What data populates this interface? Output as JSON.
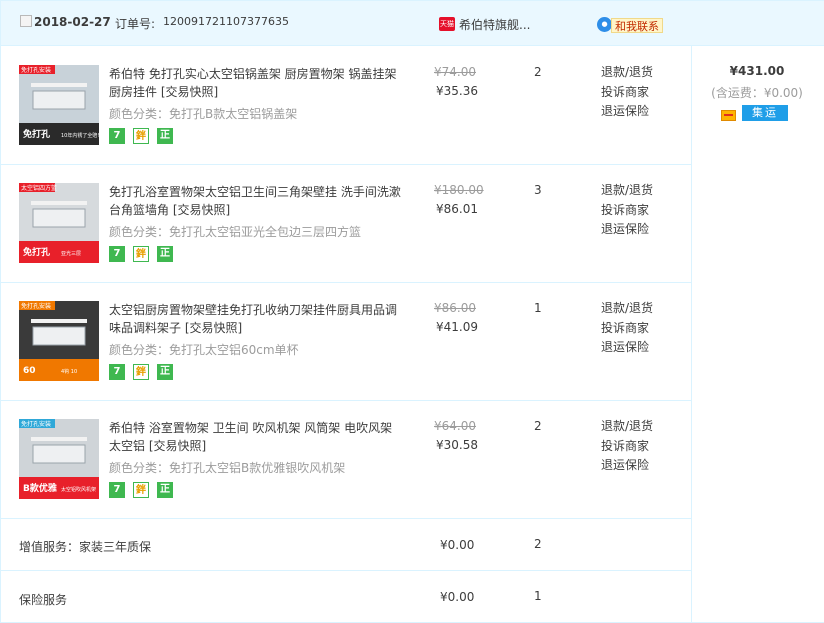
{
  "order": {
    "date": "2018-02-27",
    "order_label": "订单号:",
    "order_number": "120091721107377635",
    "tmall_icon": "天猫",
    "shop_name": "希伯特旗舰...",
    "contact_label": "和我联系",
    "contact_icon": "chat-bubble-icon"
  },
  "items": [
    {
      "title": "希伯特 免打孔实心太空铝锅盖架 厨房置物架 锅盖挂架 厨房挂件 [交易快照]",
      "spec": "颜色分类：免打孔B款太空铝锅盖架",
      "old_price": "¥74.00",
      "price": "¥35.36",
      "qty": "2",
      "thumb_text": "免打孔",
      "thumb_sub": "10年内锈了全赔!",
      "thumb_top": "免打孔安装",
      "colors": {
        "top": "#c8d2d9",
        "bottom": "#2a2a2a",
        "accent": "#e8202a"
      }
    },
    {
      "title": "免打孔浴室置物架太空铝卫生间三角架壁挂 洗手间洗漱台角篮墙角 [交易快照]",
      "spec": "颜色分类：免打孔太空铝亚光全包边三层四方篮",
      "old_price": "¥180.00",
      "price": "¥86.01",
      "qty": "3",
      "thumb_text": "免打孔",
      "thumb_sub": "亚光三层",
      "thumb_top": "太空铝四方篮",
      "colors": {
        "top": "#d6dadd",
        "bottom": "#e8202a",
        "accent": "#e8202a"
      }
    },
    {
      "title": "太空铝厨房置物架壁挂免打孔收纳刀架挂件厨具用品调味品调料架子 [交易快照]",
      "spec": "颜色分类：免打孔太空铝60cm单杯",
      "old_price": "¥86.00",
      "price": "¥41.09",
      "qty": "1",
      "thumb_text": "60",
      "thumb_sub": "4钩 10",
      "thumb_top": "免打孔安装",
      "colors": {
        "top": "#3a3a3a",
        "bottom": "#f07800",
        "accent": "#f07800"
      }
    },
    {
      "title": "希伯特 浴室置物架 卫生间 吹风机架 风筒架 电吹风架 太空铝 [交易快照]",
      "spec": "颜色分类：免打孔太空铝B款优雅银吹风机架",
      "old_price": "¥64.00",
      "price": "¥30.58",
      "qty": "2",
      "thumb_text": "B款优雅",
      "thumb_sub": "太空铝吹风机架",
      "thumb_top": "免打孔安装",
      "colors": {
        "top": "#cfd4d8",
        "bottom": "#e8202a",
        "accent": "#2fa8d8"
      }
    }
  ],
  "badges": {
    "seven": "7",
    "bao": "鉡",
    "zheng": "正"
  },
  "actions": [
    "退款/退货",
    "投诉商家",
    "退运保险"
  ],
  "total": {
    "amount": "¥431.00",
    "shipping": "(含运费：¥0.00)",
    "jiyun_label": "集运",
    "card_icon": "bank-card-icon"
  },
  "services": [
    {
      "label": "增值服务：家装三年质保",
      "price": "¥0.00",
      "qty": "2"
    },
    {
      "label": "保险服务",
      "price": "¥0.00",
      "qty": "1"
    }
  ],
  "colors": {
    "border": "#daf3ff",
    "header_bg": "#eaf8ff",
    "badge_green": "#3fb850",
    "jiyun_blue": "#1f9ee8",
    "contact_red": "#c22b00"
  }
}
